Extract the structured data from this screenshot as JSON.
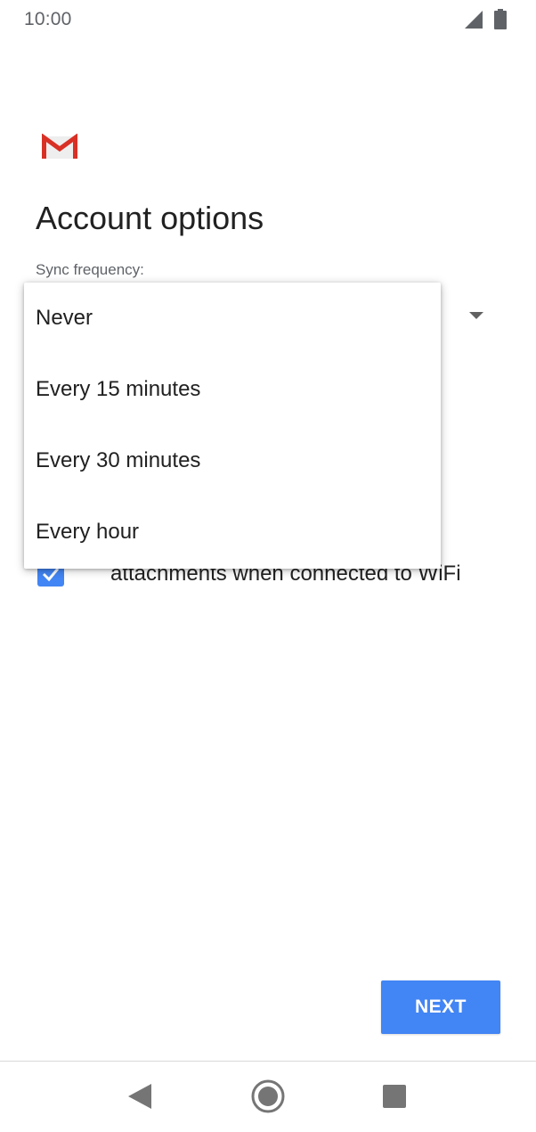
{
  "status_bar": {
    "time": "10:00",
    "signal_icon": "cell-signal-icon",
    "battery_icon": "battery-icon"
  },
  "header": {
    "logo_icon": "gmail-logo-icon",
    "title": "Account options"
  },
  "sync": {
    "label": "Sync frequency:",
    "options": [
      "Never",
      "Every 15 minutes",
      "Every 30 minutes",
      "Every hour"
    ]
  },
  "attachments": {
    "checked": true,
    "label": "attachments when connected to WiFi"
  },
  "footer": {
    "next_label": "NEXT"
  },
  "nav": {
    "back_icon": "back-triangle-icon",
    "home_icon": "home-circle-icon",
    "recents_icon": "recents-square-icon"
  },
  "colors": {
    "accent": "#4285f4",
    "gmail_red": "#d93025",
    "text_primary": "#212121",
    "text_secondary": "#5f6368"
  }
}
